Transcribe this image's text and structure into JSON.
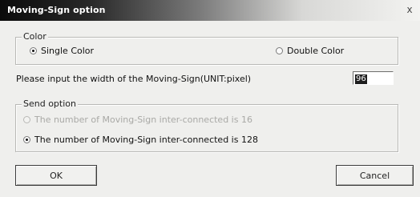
{
  "window": {
    "title": "Moving-Sign option",
    "close_label": "x"
  },
  "color_group": {
    "label": "Color",
    "single_color": {
      "label": "Single Color",
      "checked": true
    },
    "double_color": {
      "label": "Double Color",
      "checked": false
    }
  },
  "width": {
    "prompt": "Please input the width of the Moving-Sign(UNIT:pixel)",
    "value": "96"
  },
  "send_group": {
    "label": "Send option",
    "option_16": {
      "label": "The number of Moving-Sign inter-connected is 16",
      "checked": false,
      "enabled": false
    },
    "option_128": {
      "label": "The number of Moving-Sign inter-connected is 128",
      "checked": true,
      "enabled": true
    }
  },
  "buttons": {
    "ok": "OK",
    "cancel": "Cancel"
  }
}
